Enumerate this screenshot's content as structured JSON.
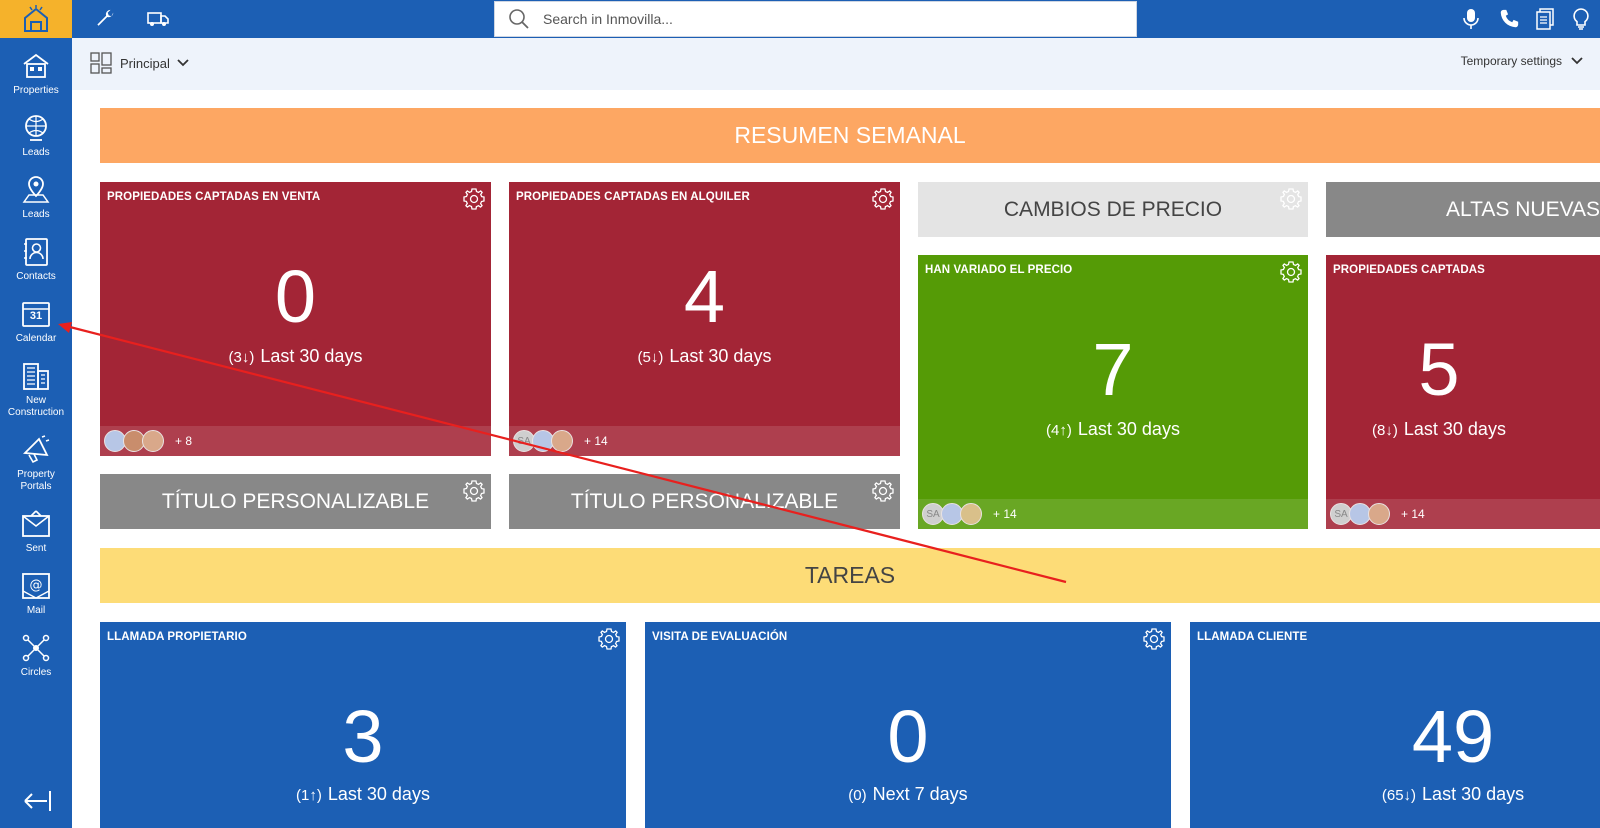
{
  "topbar": {
    "search_placeholder": "Search in Inmovilla..."
  },
  "sidebar": {
    "items": [
      {
        "label": "Properties",
        "icon": "house-icon"
      },
      {
        "label": "Leads",
        "icon": "globe-leads-icon"
      },
      {
        "label": "Leads",
        "icon": "map-pin-leads-icon"
      },
      {
        "label": "Contacts",
        "icon": "contact-card-icon"
      },
      {
        "label": "Calendar",
        "icon": "calendar-icon",
        "day": "31"
      },
      {
        "label": "New Construction",
        "icon": "building-icon"
      },
      {
        "label": "Property Portals",
        "icon": "megaphone-icon"
      },
      {
        "label": "Sent",
        "icon": "sent-mail-icon"
      },
      {
        "label": "Mail",
        "icon": "at-mail-icon"
      },
      {
        "label": "Circles",
        "icon": "network-icon"
      }
    ]
  },
  "subheader": {
    "view_label": "Principal",
    "settings_label": "Temporary settings"
  },
  "sections": {
    "weekly": "RESUMEN SEMANAL",
    "tasks": "TAREAS"
  },
  "tiles": {
    "venta": {
      "title": "PROPIEDADES CAPTADAS EN VENTA",
      "value": "0",
      "delta": "(3↓)",
      "period": "Last 30 days",
      "more": "+ 8"
    },
    "alquiler": {
      "title": "PROPIEDADES CAPTADAS EN ALQUILER",
      "value": "4",
      "delta": "(5↓)",
      "period": "Last 30 days",
      "more": "+ 14"
    },
    "cambios_header": "CAMBIOS DE PRECIO",
    "altas_header": "ALTAS NUEVAS",
    "han_variado": {
      "title": "HAN VARIADO EL PRECIO",
      "value": "7",
      "delta": "(4↑)",
      "period": "Last 30 days",
      "more": "+ 14"
    },
    "captadas": {
      "title": "PROPIEDADES CAPTADAS",
      "value": "5",
      "delta": "(8↓)",
      "period": "Last 30 days",
      "more": "+ 14"
    },
    "custom1": "TÍTULO PERSONALIZABLE",
    "custom2": "TÍTULO PERSONALIZABLE",
    "llamada_prop": {
      "title": "LLAMADA PROPIETARIO",
      "value": "3",
      "delta": "(1↑)",
      "period": "Last 30 days"
    },
    "visita": {
      "title": "VISITA DE EVALUACIÓN",
      "value": "0",
      "delta": "(0)",
      "period": "Next 7 days"
    },
    "llamada_cli": {
      "title": "LLAMADA CLIENTE",
      "value": "49",
      "delta": "(65↓)",
      "period": "Last 30 days"
    }
  },
  "avatars": {
    "initials": "SA"
  },
  "colors": {
    "primary_blue": "#1c5fb4",
    "logo_yellow": "#f5b22b",
    "tile_red": "#a32536",
    "tile_green": "#559b06",
    "section_orange": "#fda763",
    "section_yellow": "#fddc77",
    "annotation_arrow": "#e8201e"
  }
}
